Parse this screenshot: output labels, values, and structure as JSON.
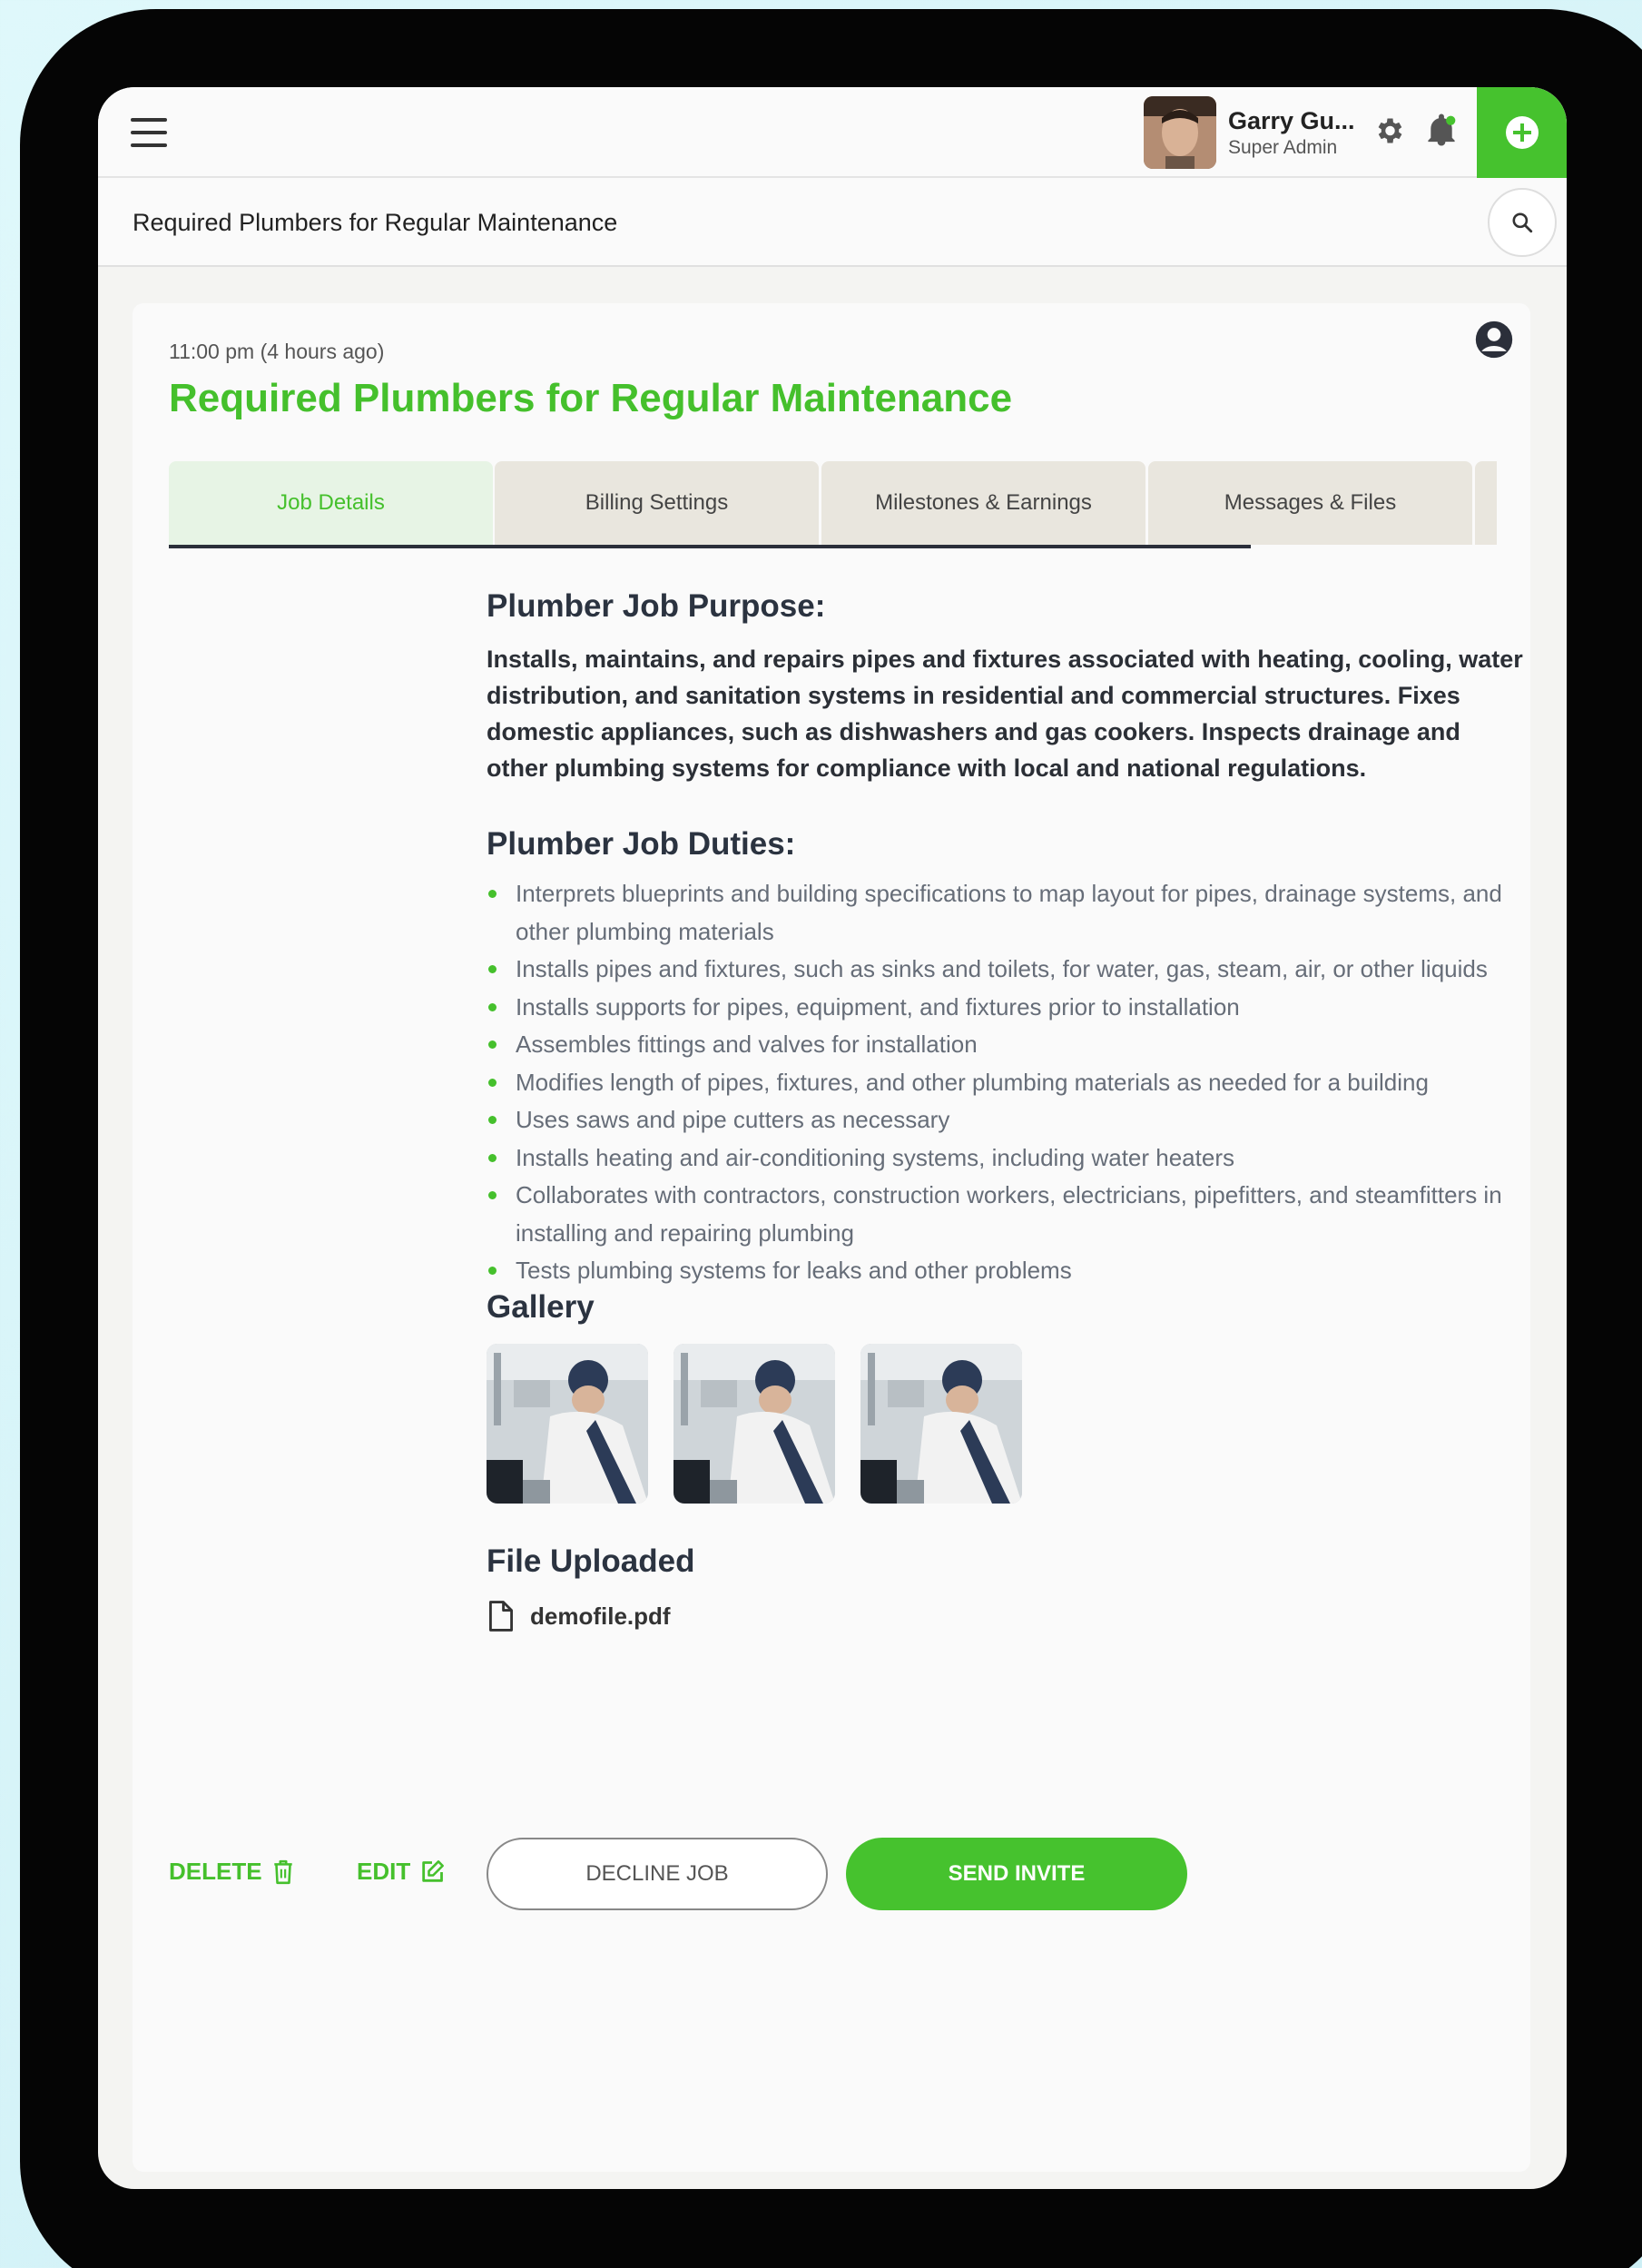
{
  "header": {
    "user_name": "Garry Gu...",
    "user_role": "Super Admin"
  },
  "subbar": {
    "title": "Required Plumbers for Regular Maintenance"
  },
  "job": {
    "timestamp": "11:00 pm (4 hours ago)",
    "title": "Required Plumbers for Regular Maintenance"
  },
  "tabs": [
    {
      "label": "Job Details",
      "active": true
    },
    {
      "label": "Billing Settings"
    },
    {
      "label": "Milestones & Earnings"
    },
    {
      "label": "Messages & Files"
    }
  ],
  "purpose": {
    "heading": "Plumber Job Purpose:",
    "text": "Installs, maintains, and repairs pipes and fixtures associated with heating, cooling, water distribution, and sanitation systems in residential and commercial structures. Fixes domestic appliances, such as dishwashers and gas cookers. Inspects drainage and other plumbing systems for compliance with local and national regulations."
  },
  "duties": {
    "heading": "Plumber Job Duties:",
    "items": [
      "Interprets blueprints and building specifications to map layout for pipes, drainage systems, and other plumbing materials",
      "Installs pipes and fixtures, such as sinks and toilets, for water, gas, steam, air, or other liquids",
      "Installs supports for pipes, equipment, and fixtures prior to installation",
      "Assembles fittings and valves for installation",
      "Modifies length of pipes, fixtures, and other plumbing materials as needed for a building",
      "Uses saws and pipe cutters as necessary",
      "Installs heating and air-conditioning systems, including water heaters",
      "Collaborates with contractors, construction workers, electricians, pipefitters, and steamfitters in installing and repairing plumbing",
      "Tests plumbing systems for leaks and other problems"
    ]
  },
  "gallery": {
    "heading": "Gallery"
  },
  "files": {
    "heading": "File Uploaded",
    "name": "demofile.pdf"
  },
  "actions": {
    "delete": "DELETE",
    "edit": "EDIT",
    "decline": "DECLINE JOB",
    "invite": "SEND INVITE"
  },
  "colors": {
    "accent": "#46c22e",
    "tab_active_bg": "#e7f4e5",
    "tab_bg": "#e9e6de"
  },
  "icons": [
    "menu-icon",
    "gear-icon",
    "bell-icon",
    "plus-icon",
    "search-icon",
    "user-circle-icon",
    "file-icon",
    "trash-icon",
    "edit-icon"
  ]
}
